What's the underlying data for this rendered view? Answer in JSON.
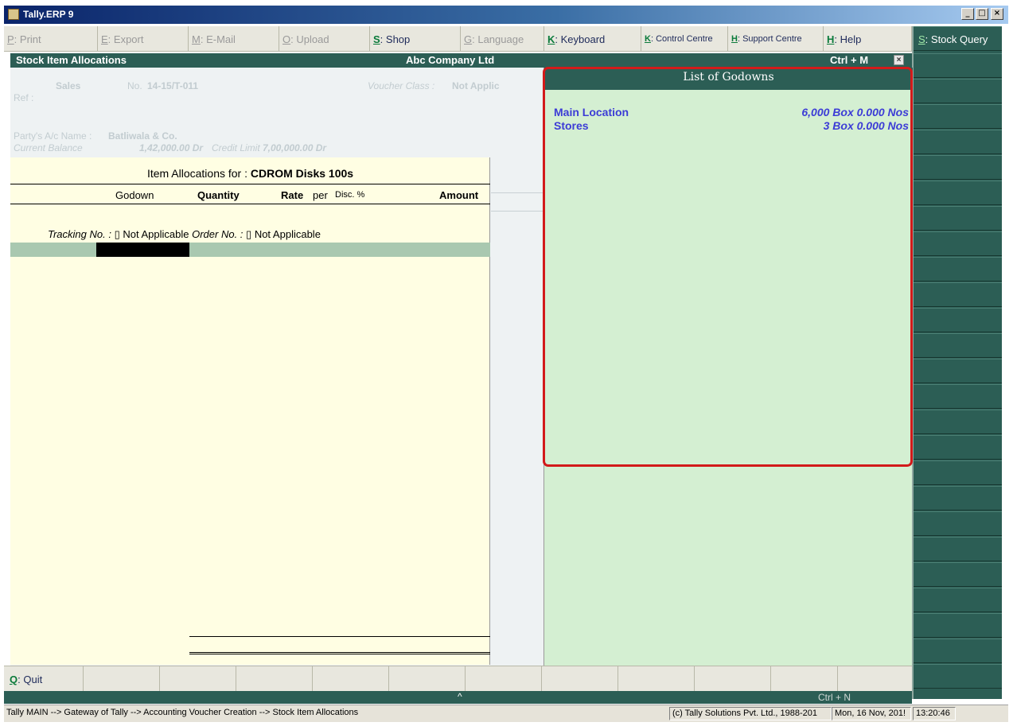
{
  "window": {
    "title": "Tally.ERP 9",
    "buttons": [
      "_",
      "□",
      "×"
    ]
  },
  "topbar": [
    {
      "key": "P",
      "label": ": Print",
      "enabled": false
    },
    {
      "key": "E",
      "label": ": Export",
      "enabled": false
    },
    {
      "key": "M",
      "label": ": E-Mail",
      "enabled": false
    },
    {
      "key": "O",
      "label": ": Upload",
      "enabled": false
    },
    {
      "key": "S",
      "label": ": Shop",
      "enabled": true
    },
    {
      "key": "G",
      "label": ": Language",
      "enabled": false
    },
    {
      "key": "K",
      "label": ": Keyboard",
      "enabled": true
    },
    {
      "key": "K",
      "label": ": Control Centre",
      "enabled": true
    },
    {
      "key": "H",
      "label": ": Support Centre",
      "enabled": true
    },
    {
      "key": "H",
      "label": ": Help",
      "enabled": true
    }
  ],
  "sidebar": {
    "first": {
      "key": "S",
      "label": ": Stock Query"
    }
  },
  "header": {
    "left": "Stock Item Allocations",
    "center": "Abc Company Ltd",
    "right": "Ctrl + M",
    "close": "×"
  },
  "voucher": {
    "type": "Sales",
    "no_label": "No.",
    "no_value": "14-15/T-011",
    "class_label": "Voucher Class :",
    "class_value": "Not Applic",
    "ref_label": "Ref :",
    "party_label": "Party's A/c Name :",
    "party_value": "Batliwala & Co.",
    "balance_label": "Current Balance",
    "balance_value": "1,42,000.00 Dr",
    "credit_label": "Credit Limit",
    "credit_value": "7,00,000.00 Dr"
  },
  "allocation": {
    "title_label": "Item Allocations for :",
    "item_name": "CDROM Disks 100s",
    "columns": {
      "godown": "Godown",
      "quantity": "Quantity",
      "rate": "Rate",
      "per": "per",
      "disc": "Disc. %",
      "amount": "Amount"
    },
    "tracking_label": "Tracking No. :",
    "tracking_value": "Not Applicable",
    "order_label": "Order No. :",
    "order_value": "Not Applicable"
  },
  "godowns": {
    "title": "List of Godowns",
    "items": [
      {
        "name": "Main Location",
        "balance": "6,000 Box 0.000 Nos"
      },
      {
        "name": "Stores",
        "balance": "3 Box 0.000 Nos"
      }
    ]
  },
  "bottombar": {
    "quit_key": "Q",
    "quit_label": ": Quit",
    "up_arrow": "^",
    "ctrl_n": "Ctrl + N"
  },
  "statusbar": {
    "path": "Tally MAIN --> Gateway of Tally --> Accounting Voucher  Creation  --> Stock Item Allocations",
    "copyright": "(c) Tally Solutions Pvt. Ltd., 1988-201",
    "date": "Mon, 16 Nov, 201!",
    "time": "13:20:46"
  },
  "colors": {
    "accent": "#2c5e55",
    "highlight": "#d21a1a",
    "godown_text": "#3c3cd6",
    "alloc_bg": "#fffee3",
    "godown_bg": "#d4efd2"
  }
}
